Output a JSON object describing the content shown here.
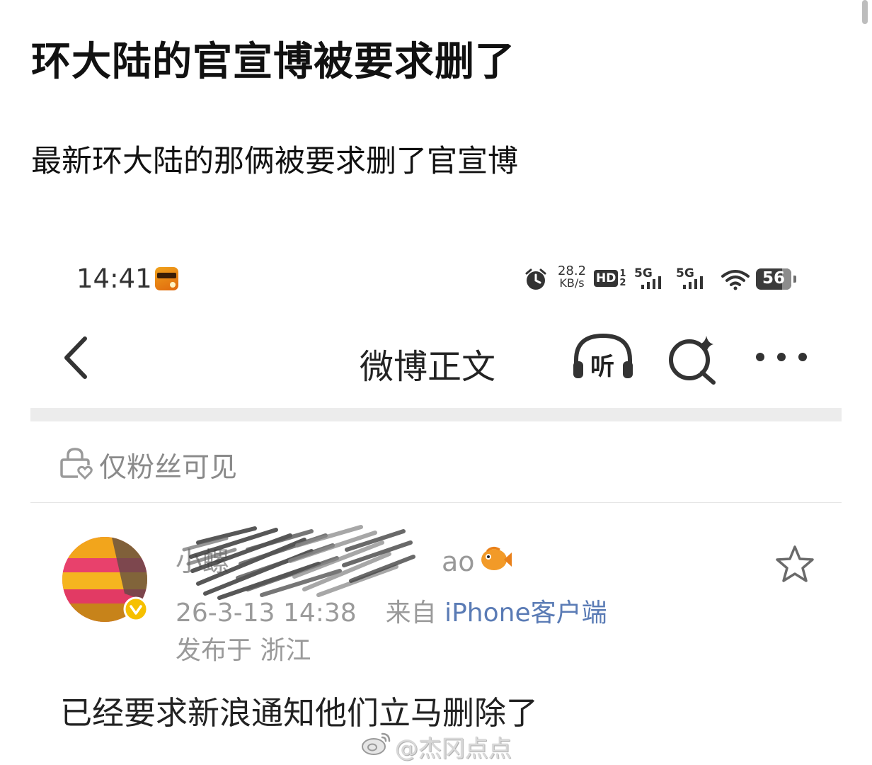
{
  "post": {
    "title": "环大陆的官宣博被要求删了",
    "body": "最新环大陆的那俩被要求删了官宣博"
  },
  "screenshot": {
    "status_bar": {
      "time": "14:41",
      "net_speed_value": "28.2",
      "net_speed_unit": "KB/s",
      "hd_label": "HD",
      "sim1_label": "5G",
      "sim2_label": "5G",
      "battery": "56"
    },
    "nav": {
      "title": "微博正文",
      "listen_label": "听"
    },
    "visibility": "仅粉丝可见",
    "author": {
      "name_visible": "小螺",
      "name_suffix": "ao",
      "date": "26-3-13 14:38",
      "source_prefix": "来自",
      "source": "iPhone客户端",
      "location": "发布于 浙江"
    },
    "content": "已经要求新浪通知他们立马删除了",
    "watermark": "@杰冈点点"
  },
  "colors": {
    "verified_badge": "#f6c000",
    "source_link": "#5a7bb5",
    "meta_gray": "#9a9a9a"
  }
}
